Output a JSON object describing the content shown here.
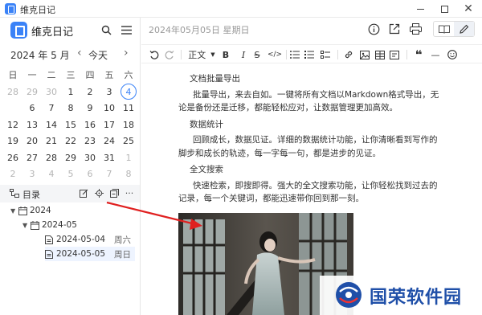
{
  "window": {
    "title": "维克日记"
  },
  "sidebar": {
    "app_name": "维克日记",
    "calendar": {
      "month_label": "2024 年 5 月",
      "today_label": "今天",
      "prev_arrow": "‹",
      "next_arrow": "›",
      "weekdays": [
        "日",
        "一",
        "二",
        "三",
        "四",
        "五",
        "六"
      ],
      "weeks": [
        [
          "28",
          "29",
          "30",
          "1",
          "2",
          "3",
          "4"
        ],
        [
          "5",
          "6",
          "7",
          "8",
          "9",
          "10",
          "11"
        ],
        [
          "12",
          "13",
          "14",
          "15",
          "16",
          "17",
          "18"
        ],
        [
          "19",
          "20",
          "21",
          "22",
          "23",
          "24",
          "25"
        ],
        [
          "26",
          "27",
          "28",
          "29",
          "30",
          "31",
          "1"
        ],
        [
          "2",
          "3",
          "4",
          "5",
          "6",
          "7",
          "8"
        ]
      ],
      "selected_day": "5",
      "marked_day": "4",
      "accent_color": "#3a82f7"
    },
    "tree": {
      "title": "目录",
      "actions": [
        "edit-icon",
        "locate-icon",
        "collapse-icon",
        "more-icon"
      ],
      "more_label": "···",
      "items": [
        {
          "label": "2024",
          "level": 0,
          "type": "folder"
        },
        {
          "label": "2024-05",
          "level": 1,
          "type": "folder"
        },
        {
          "label": "2024-05-04",
          "weekday": "周六",
          "level": 2,
          "type": "file"
        },
        {
          "label": "2024-05-05",
          "weekday": "周日",
          "level": 2,
          "type": "file",
          "selected": true
        }
      ]
    }
  },
  "editor": {
    "date_title": "2024年05月05日 星期日",
    "header_icons": [
      "info-icon",
      "export-icon",
      "print-icon"
    ],
    "mode_buttons": [
      "read-mode-icon",
      "edit-mode-icon"
    ],
    "toolbar": {
      "style_select": "正文",
      "bold": "B",
      "italic": "I",
      "strike": "S",
      "code": "</>",
      "quote": "❝",
      "hr": "—"
    },
    "content": [
      {
        "kind": "heading",
        "text": "文档批量导出"
      },
      {
        "kind": "para",
        "text": "批量导出，来去自如。一键将所有文档以Markdown格式导出，无论是备份还是迁移，都能轻松应对，让数据管理更加高效。"
      },
      {
        "kind": "heading",
        "text": "数据统计"
      },
      {
        "kind": "para",
        "text": "回顾成长，数据见证。详细的数据统计功能，让你清晰看到写作的脚步和成长的轨迹，每一字每一句，都是进步的见证。"
      },
      {
        "kind": "heading",
        "text": "全文搜索"
      },
      {
        "kind": "para",
        "text": "快速检索，即搜即得。强大的全文搜索功能，让你轻松找到过去的记录，每一个关键词，都能迅速带你回到那一刻。"
      }
    ]
  },
  "watermark": {
    "text": "国荣软件园"
  }
}
